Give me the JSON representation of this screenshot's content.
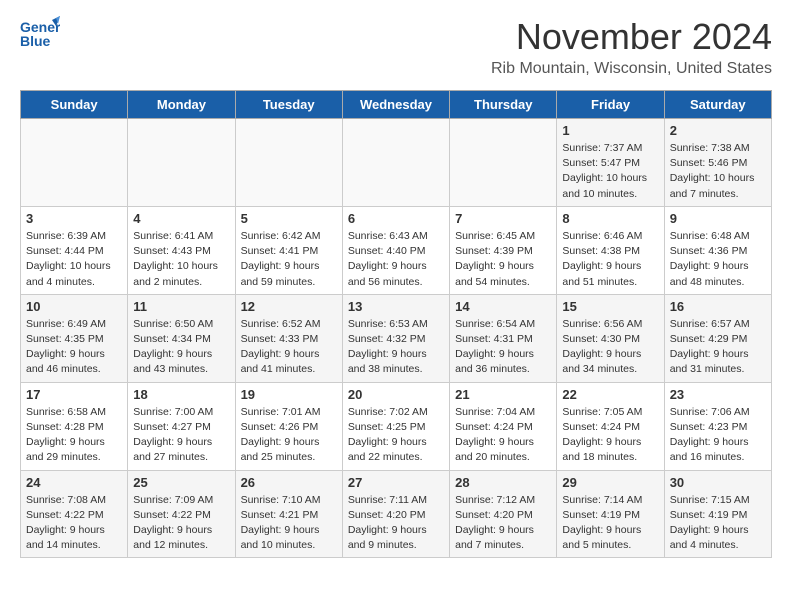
{
  "header": {
    "logo_line1": "General",
    "logo_line2": "Blue",
    "month": "November 2024",
    "location": "Rib Mountain, Wisconsin, United States"
  },
  "days_of_week": [
    "Sunday",
    "Monday",
    "Tuesday",
    "Wednesday",
    "Thursday",
    "Friday",
    "Saturday"
  ],
  "weeks": [
    [
      {
        "day": "",
        "info": ""
      },
      {
        "day": "",
        "info": ""
      },
      {
        "day": "",
        "info": ""
      },
      {
        "day": "",
        "info": ""
      },
      {
        "day": "",
        "info": ""
      },
      {
        "day": "1",
        "info": "Sunrise: 7:37 AM\nSunset: 5:47 PM\nDaylight: 10 hours and 10 minutes."
      },
      {
        "day": "2",
        "info": "Sunrise: 7:38 AM\nSunset: 5:46 PM\nDaylight: 10 hours and 7 minutes."
      }
    ],
    [
      {
        "day": "3",
        "info": "Sunrise: 6:39 AM\nSunset: 4:44 PM\nDaylight: 10 hours and 4 minutes."
      },
      {
        "day": "4",
        "info": "Sunrise: 6:41 AM\nSunset: 4:43 PM\nDaylight: 10 hours and 2 minutes."
      },
      {
        "day": "5",
        "info": "Sunrise: 6:42 AM\nSunset: 4:41 PM\nDaylight: 9 hours and 59 minutes."
      },
      {
        "day": "6",
        "info": "Sunrise: 6:43 AM\nSunset: 4:40 PM\nDaylight: 9 hours and 56 minutes."
      },
      {
        "day": "7",
        "info": "Sunrise: 6:45 AM\nSunset: 4:39 PM\nDaylight: 9 hours and 54 minutes."
      },
      {
        "day": "8",
        "info": "Sunrise: 6:46 AM\nSunset: 4:38 PM\nDaylight: 9 hours and 51 minutes."
      },
      {
        "day": "9",
        "info": "Sunrise: 6:48 AM\nSunset: 4:36 PM\nDaylight: 9 hours and 48 minutes."
      }
    ],
    [
      {
        "day": "10",
        "info": "Sunrise: 6:49 AM\nSunset: 4:35 PM\nDaylight: 9 hours and 46 minutes."
      },
      {
        "day": "11",
        "info": "Sunrise: 6:50 AM\nSunset: 4:34 PM\nDaylight: 9 hours and 43 minutes."
      },
      {
        "day": "12",
        "info": "Sunrise: 6:52 AM\nSunset: 4:33 PM\nDaylight: 9 hours and 41 minutes."
      },
      {
        "day": "13",
        "info": "Sunrise: 6:53 AM\nSunset: 4:32 PM\nDaylight: 9 hours and 38 minutes."
      },
      {
        "day": "14",
        "info": "Sunrise: 6:54 AM\nSunset: 4:31 PM\nDaylight: 9 hours and 36 minutes."
      },
      {
        "day": "15",
        "info": "Sunrise: 6:56 AM\nSunset: 4:30 PM\nDaylight: 9 hours and 34 minutes."
      },
      {
        "day": "16",
        "info": "Sunrise: 6:57 AM\nSunset: 4:29 PM\nDaylight: 9 hours and 31 minutes."
      }
    ],
    [
      {
        "day": "17",
        "info": "Sunrise: 6:58 AM\nSunset: 4:28 PM\nDaylight: 9 hours and 29 minutes."
      },
      {
        "day": "18",
        "info": "Sunrise: 7:00 AM\nSunset: 4:27 PM\nDaylight: 9 hours and 27 minutes."
      },
      {
        "day": "19",
        "info": "Sunrise: 7:01 AM\nSunset: 4:26 PM\nDaylight: 9 hours and 25 minutes."
      },
      {
        "day": "20",
        "info": "Sunrise: 7:02 AM\nSunset: 4:25 PM\nDaylight: 9 hours and 22 minutes."
      },
      {
        "day": "21",
        "info": "Sunrise: 7:04 AM\nSunset: 4:24 PM\nDaylight: 9 hours and 20 minutes."
      },
      {
        "day": "22",
        "info": "Sunrise: 7:05 AM\nSunset: 4:24 PM\nDaylight: 9 hours and 18 minutes."
      },
      {
        "day": "23",
        "info": "Sunrise: 7:06 AM\nSunset: 4:23 PM\nDaylight: 9 hours and 16 minutes."
      }
    ],
    [
      {
        "day": "24",
        "info": "Sunrise: 7:08 AM\nSunset: 4:22 PM\nDaylight: 9 hours and 14 minutes."
      },
      {
        "day": "25",
        "info": "Sunrise: 7:09 AM\nSunset: 4:22 PM\nDaylight: 9 hours and 12 minutes."
      },
      {
        "day": "26",
        "info": "Sunrise: 7:10 AM\nSunset: 4:21 PM\nDaylight: 9 hours and 10 minutes."
      },
      {
        "day": "27",
        "info": "Sunrise: 7:11 AM\nSunset: 4:20 PM\nDaylight: 9 hours and 9 minutes."
      },
      {
        "day": "28",
        "info": "Sunrise: 7:12 AM\nSunset: 4:20 PM\nDaylight: 9 hours and 7 minutes."
      },
      {
        "day": "29",
        "info": "Sunrise: 7:14 AM\nSunset: 4:19 PM\nDaylight: 9 hours and 5 minutes."
      },
      {
        "day": "30",
        "info": "Sunrise: 7:15 AM\nSunset: 4:19 PM\nDaylight: 9 hours and 4 minutes."
      }
    ]
  ]
}
